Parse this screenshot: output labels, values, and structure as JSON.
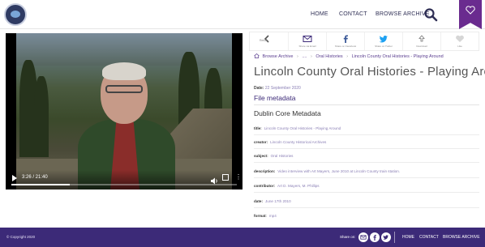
{
  "header": {
    "nav": {
      "home": "HOME",
      "contact": "CONTACT",
      "browse": "BROWSE ARCHIVE"
    },
    "icons": {
      "logo": "archive-logo",
      "search": "search-icon",
      "bookmark": "heart-icon"
    }
  },
  "video": {
    "time": "3:26 / 21:40",
    "progress": 0.26,
    "icons": {
      "play": "play-icon",
      "volume": "volume-icon",
      "fullscreen": "fullscreen-icon",
      "more": "more-vertical-icon"
    }
  },
  "share_bar": {
    "items": [
      {
        "label": "Return",
        "icon": "chevron-left-icon"
      },
      {
        "label": "Share via Email",
        "icon": "mail-icon"
      },
      {
        "label": "Share on Facebook",
        "icon": "facebook-icon"
      },
      {
        "label": "Share on Twitter",
        "icon": "twitter-icon"
      },
      {
        "label": "Download",
        "icon": "download-icon"
      },
      {
        "label": "Like",
        "icon": "heart-icon"
      }
    ]
  },
  "breadcrumb": {
    "items": [
      "Browse Archive",
      "....",
      "Oral Histories",
      "Lincoln County Oral Histories - Playing Around"
    ],
    "home_icon": "home-icon"
  },
  "record": {
    "title": "Lincoln County Oral Histories - Playing Around",
    "date_label": "Date:",
    "date_value": "22 September 2020",
    "file_metadata": "File metadata",
    "dublin_core_heading": "Dublin Core Metadata",
    "fields": [
      {
        "key": "title:",
        "value": "Lincoln County Oral Histories - Playing Around"
      },
      {
        "key": "creator:",
        "value": "Lincoln County Historical Archives"
      },
      {
        "key": "subject:",
        "value": "Oral Histories"
      },
      {
        "key": "description:",
        "value": "Video interview with Art Mayers, June 2010 at Lincoln County train station."
      },
      {
        "key": "contributor:",
        "value": "Art D. Mayers, M. Phillips"
      },
      {
        "key": "date:",
        "value": "June 17th 2010"
      },
      {
        "key": "format:",
        "value": "mp4"
      }
    ]
  },
  "footer": {
    "copyright": "© Copyright 2020",
    "share_on": "Share on:",
    "icons": [
      "mail-icon",
      "facebook-icon",
      "twitter-icon"
    ],
    "nav": {
      "home": "HOME",
      "contact": "CONTACT",
      "browse": "BROWSE ARCHIVE"
    }
  },
  "colors": {
    "brand_purple": "#3c2a78",
    "accent_purple": "#6a2b8f",
    "meta_value": "#8a7fb5"
  }
}
